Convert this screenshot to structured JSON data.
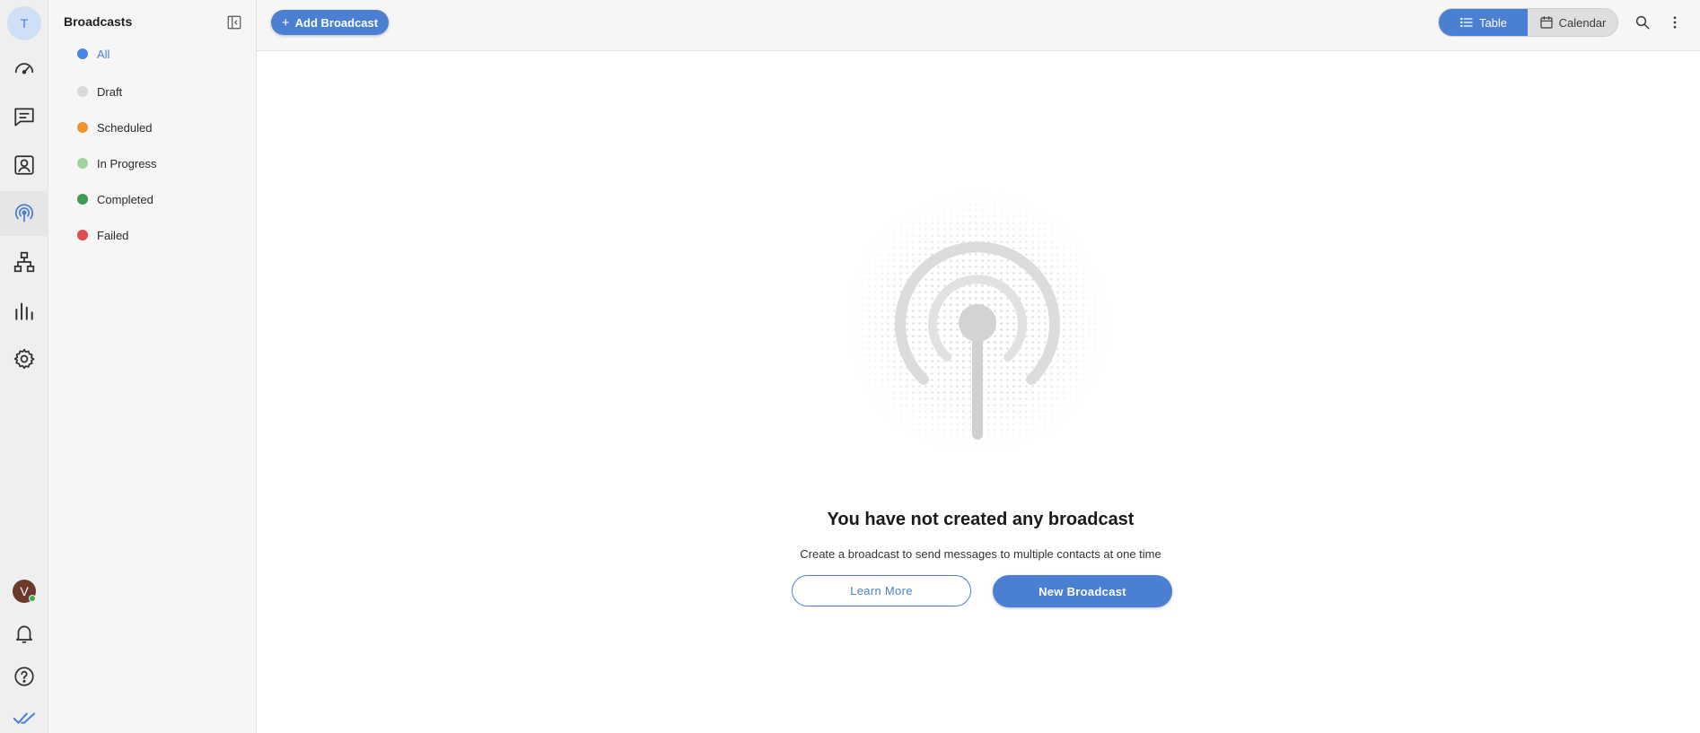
{
  "rail": {
    "workspace_initial": "T",
    "user_initial": "V",
    "items": [
      {
        "name": "dashboard-icon"
      },
      {
        "name": "conversations-icon"
      },
      {
        "name": "contacts-icon"
      },
      {
        "name": "broadcast-icon",
        "active": true
      },
      {
        "name": "workflows-icon"
      },
      {
        "name": "reports-icon"
      },
      {
        "name": "settings-icon"
      }
    ],
    "bottom": [
      "notifications-icon",
      "help-icon",
      "brand-logo-icon"
    ]
  },
  "sidebar": {
    "title": "Broadcasts",
    "statuses": [
      {
        "label": "All",
        "color": "#4a86e8",
        "active": true
      },
      {
        "label": "Draft",
        "color": "#d9d9d9"
      },
      {
        "label": "Scheduled",
        "color": "#f0932b"
      },
      {
        "label": "In Progress",
        "color": "#9fd49f"
      },
      {
        "label": "Completed",
        "color": "#3e9b4f"
      },
      {
        "label": "Failed",
        "color": "#e04a4a"
      }
    ]
  },
  "header": {
    "add_label": "Add Broadcast",
    "view_table": "Table",
    "view_calendar": "Calendar"
  },
  "empty_state": {
    "title": "You have not created any broadcast",
    "subtitle": "Create a broadcast to send messages to multiple contacts at one time",
    "learn_more": "Learn More",
    "new_broadcast": "New Broadcast"
  },
  "colors": {
    "accent": "#4a7fd1",
    "online": "#2fb24d"
  }
}
